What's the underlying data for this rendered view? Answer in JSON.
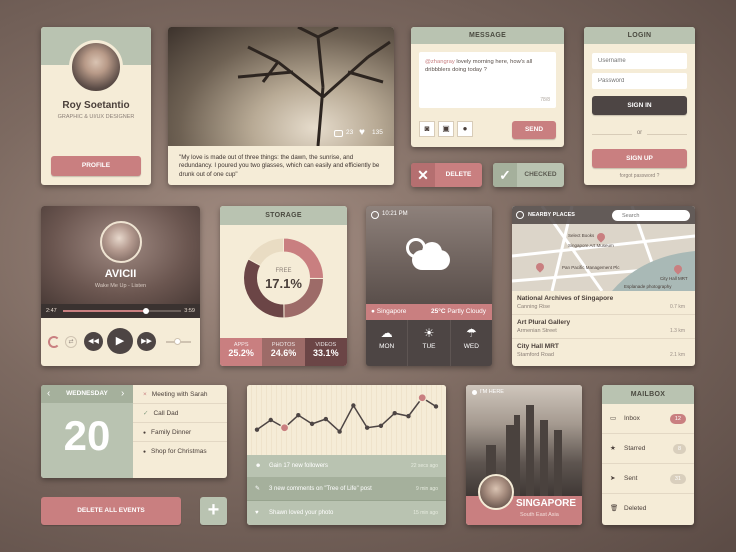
{
  "colors": {
    "pink": "#c97f80",
    "sage": "#b9c3b1",
    "cream": "#f5ecd7",
    "dark": "#4d4544"
  },
  "profile": {
    "name": "Roy Soetantio",
    "role": "GRAPHIC & UI/UX DESIGNER",
    "button": "PROFILE"
  },
  "photo": {
    "comments": "23",
    "likes": "135",
    "quote": "\"My love is made out of three things: the dawn, the sunrise, and redundancy. I poured you two glasses, which can easily and efficiently be drunk out of one cup\""
  },
  "message": {
    "header": "MESSAGE",
    "handle": "@zhangray",
    "text": " lovely morning here, how's all dribbblers doing today ?",
    "count": "78/8",
    "send": "SEND"
  },
  "actions": {
    "delete": "DELETE",
    "checked": "CHECKED"
  },
  "login": {
    "header": "LOGIN",
    "username_placeholder": "Username",
    "password_placeholder": "Password",
    "signin": "SIGN IN",
    "or": "or",
    "signup": "SIGN UP",
    "forgot": "forgot password ?"
  },
  "music": {
    "artist": "AVICII",
    "track": "Wake Me Up - Listen",
    "elapsed": "2:47",
    "total": "3:59",
    "progress": 0.7,
    "volume": 0.45
  },
  "storage": {
    "header": "STORAGE",
    "free_label": "FREE",
    "free_value": "17.1%",
    "free_fraction": 0.171,
    "segments": [
      {
        "label": "APPS",
        "value": "25.2%",
        "fraction": 0.252,
        "color": "#c97f80"
      },
      {
        "label": "PHOTOS",
        "value": "24.6%",
        "fraction": 0.246,
        "color": "#9d6b68"
      },
      {
        "label": "VIDEOS",
        "value": "33.1%",
        "fraction": 0.331,
        "color": "#6b4546"
      }
    ]
  },
  "weather": {
    "time": "10:21 PM",
    "city": "Singapore",
    "temp": "25°C",
    "condition": "Partly Cloudy",
    "days": [
      {
        "day": "MON"
      },
      {
        "day": "TUE"
      },
      {
        "day": "WED"
      }
    ]
  },
  "map": {
    "header": "NEARBY PLACES",
    "search_placeholder": "Search",
    "pins": [
      "Select Books",
      "Singapore Art Museum",
      "Pan Pacific Management Plc",
      "City Hall MRT",
      "Esplanade photography"
    ],
    "places": [
      {
        "name": "National Archives of Singapore",
        "street": "Canning Rise",
        "dist": "0.7 km"
      },
      {
        "name": "Art Plural Gallery",
        "street": "Armenian Street",
        "dist": "1.3 km"
      },
      {
        "name": "City Hall MRT",
        "street": "Stamford Road",
        "dist": "2.1 km"
      }
    ]
  },
  "calendar": {
    "weekday": "WEDNESDAY",
    "day": "20",
    "events": [
      {
        "text": "Meeting with Sarah",
        "mark": "×"
      },
      {
        "text": "Call Dad",
        "mark": "✓"
      },
      {
        "text": "Family Dinner",
        "mark": "●"
      },
      {
        "text": "Shop for Christmas",
        "mark": "●"
      }
    ],
    "delete_all": "DELETE ALL EVENTS",
    "add": "+"
  },
  "activity": {
    "chart_data": {
      "type": "line",
      "values": [
        2,
        3,
        2.2,
        3.5,
        2.6,
        3.1,
        1.8,
        4.5,
        2.2,
        2.4,
        3.7,
        3.4,
        5.3,
        4.4
      ]
    },
    "feed": [
      {
        "text": "Gain 17 new followers",
        "time": "22 secs ago"
      },
      {
        "text": "3 new comments on \"Tree of Life\" post",
        "time": "9 min ago"
      },
      {
        "text": "Shawn loved your photo",
        "time": "15 min ago"
      }
    ]
  },
  "location": {
    "label": "I'M HERE",
    "city": "SINGAPORE",
    "region": "South East Asia"
  },
  "mailbox": {
    "header": "MAILBOX",
    "items": [
      {
        "label": "Inbox",
        "count": "12"
      },
      {
        "label": "Starred",
        "count": "8"
      },
      {
        "label": "Sent",
        "count": "31"
      },
      {
        "label": "Deleted",
        "count": ""
      }
    ]
  }
}
